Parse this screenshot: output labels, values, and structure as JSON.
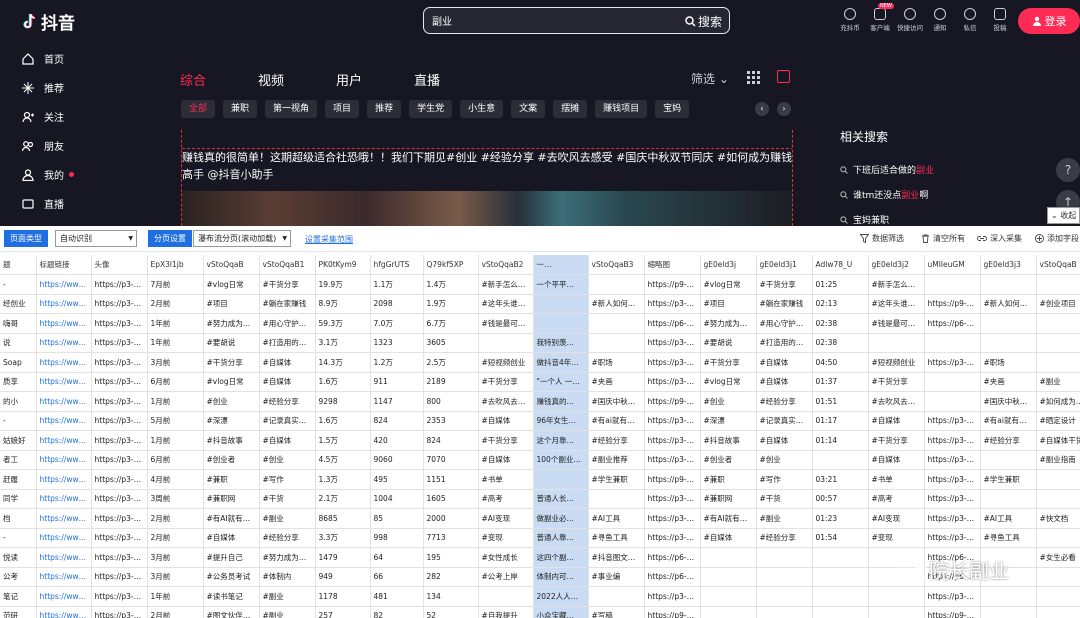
{
  "app": {
    "name": "抖音"
  },
  "search": {
    "value": "副业",
    "button": "搜索"
  },
  "tools": [
    {
      "label": "充抖币",
      "new": ""
    },
    {
      "label": "客户端",
      "new": "NEW"
    },
    {
      "label": "快捷访问",
      "new": ""
    },
    {
      "label": "通知",
      "new": ""
    },
    {
      "label": "私信",
      "new": ""
    },
    {
      "label": "投稿",
      "new": ""
    }
  ],
  "login": "登录",
  "sidebar": [
    {
      "label": "首页"
    },
    {
      "label": "推荐"
    },
    {
      "label": "关注"
    },
    {
      "label": "朋友"
    },
    {
      "label": "我的"
    },
    {
      "label": "直播"
    }
  ],
  "tabs": [
    "综合",
    "视频",
    "用户",
    "直播"
  ],
  "filter": "筛选",
  "categories": [
    "全部",
    "兼职",
    "第一视角",
    "项目",
    "推荐",
    "学生党",
    "小生意",
    "文案",
    "摆摊",
    "赚钱项目",
    "宝妈",
    "创"
  ],
  "post": {
    "text": "赚钱真的很简单！这期超级适合社恐哦！！我们下期见#创业 #经验分享 #去吹风去感受 #国庆中秋双节同庆 #如何成为赚钱高手 @抖音小助手"
  },
  "related": {
    "title": "相关搜索",
    "items": [
      {
        "pre": "下班后适合做的",
        "hl": "副业"
      },
      {
        "pre": "谁tm还没点",
        "hl": "副业",
        "post": "啊"
      },
      {
        "pre": "宝妈兼职",
        "hl": "",
        "post": ""
      }
    ]
  },
  "collapse": "收起",
  "panel": {
    "page_type_btn": "页面类型",
    "page_type_val": "自动识别",
    "paging_btn": "分页设置",
    "paging_val": "瀑布流分页(滚动加载)",
    "range_link": "设置采集范围",
    "actions": [
      "数据筛选",
      "清空所有",
      "深入采集",
      "添加字段"
    ]
  },
  "table": {
    "headers": [
      "题",
      "标题链接",
      "头像",
      "EpX3l1jb",
      "vStoQqaB",
      "vStoQqaB1",
      "PK0tKym9",
      "hfgGrUTS",
      "Q79kf5XP",
      "vStoQqaB2",
      "一…",
      "vStoQqaB3",
      "缩略图",
      "gE0eld3j",
      "gE0eld3j1",
      "Adlw78_U",
      "gE0eld3j2",
      "uMIleuGM",
      "gE0eld3j3",
      "vStoQqaB"
    ],
    "rows": [
      [
        "-",
        "https://ww…",
        "https://p3-…",
        "7月前",
        "#vlog日常",
        "#干货分享",
        "19.9万",
        "1.1万",
        "1.4万",
        "#新手怎么…",
        "一个平平…",
        "",
        "https://p9-…",
        "#vlog日常",
        "#干货分享",
        "01:25",
        "#新手怎么…",
        "",
        "",
        ""
      ],
      [
        "经创业",
        "https://ww…",
        "https://p3-…",
        "2月前",
        "#项目",
        "#躺在家赚钱",
        "8.9万",
        "2098",
        "1.9万",
        "#这年头谁…",
        "",
        "#新人如何…",
        "https://p3-…",
        "#项目",
        "#躺在家赚钱",
        "02:13",
        "#这年头谁…",
        "https://p9-…",
        "#新人如何…",
        "#创业项目"
      ],
      [
        "嗨哥",
        "https://ww…",
        "https://p3-…",
        "1年前",
        "#努力成为…",
        "#用心守护…",
        "59.3万",
        "7.0万",
        "6.7万",
        "#钱是最可…",
        "",
        "",
        "https://p6-…",
        "#努力成为…",
        "#用心守护…",
        "02:38",
        "#钱是最可…",
        "https://p6-…",
        "",
        ""
      ],
      [
        "说",
        "https://ww…",
        "https://p3-…",
        "1年前",
        "#要胡说",
        "#打造用的…",
        "3.1万",
        "1323",
        "3605",
        "",
        "我特别羡…",
        "",
        "https://p3-…",
        "#要胡说",
        "#打造用的…",
        "02:38",
        "",
        "",
        "",
        ""
      ],
      [
        "Soap",
        "https://ww…",
        "https://p3-…",
        "3月前",
        "#干货分享",
        "#自媒体",
        "14.3万",
        "1.2万",
        "2.5万",
        "#短视频创业",
        "做抖音4年…",
        "#职场",
        "https://p3-…",
        "#干货分享",
        "#自媒体",
        "04:50",
        "#短视频创业",
        "https://p3-…",
        "#职场",
        ""
      ],
      [
        "质享",
        "https://ww…",
        "https://p3-…",
        "6月前",
        "#vlog日常",
        "#自媒体",
        "1.6万",
        "911",
        "2189",
        "#干货分享",
        "\"一个人 一…",
        "#夹画",
        "https://p3-…",
        "#vlog日常",
        "#自媒体",
        "01:37",
        "#干货分享",
        "",
        "#夹画",
        "#副业"
      ],
      [
        "的小",
        "https://ww…",
        "https://p3-…",
        "1月前",
        "#创业",
        "#经验分享",
        "9298",
        "1147",
        "800",
        "#去吹风去…",
        "赚钱真的…",
        "#国庆中秋…",
        "https://p9-…",
        "#创业",
        "#经验分享",
        "01:51",
        "#去吹风去…",
        "",
        "#国庆中秋…",
        "#如何成为…"
      ],
      [
        "-",
        "https://ww…",
        "https://p3-…",
        "5月前",
        "#深漂",
        "#记录真实…",
        "1.6万",
        "824",
        "2353",
        "#自媒体",
        "96年女生…",
        "#有ai就有…",
        "https://p3-…",
        "#深漂",
        "#记录真实…",
        "01:17",
        "#自媒体",
        "https://p3-…",
        "#有ai就有…",
        "#晒定设计"
      ],
      [
        "姑娘好",
        "https://ww…",
        "https://p3-…",
        "1月前",
        "#抖音故事",
        "#自媒体",
        "1.5万",
        "420",
        "824",
        "#干货分享",
        "这个月靠…",
        "#经验分享",
        "https://p3-…",
        "#抖音故事",
        "#自媒体",
        "01:14",
        "#干货分享",
        "https://p3-…",
        "#经验分享",
        "#自媒体干货"
      ],
      [
        "者工",
        "https://ww…",
        "https://p3-…",
        "6月前",
        "#创业者",
        "#创业",
        "4.5万",
        "9060",
        "7070",
        "#自媒体",
        "100个副业…",
        "#副业推荐",
        "https://p3-…",
        "#创业者",
        "#创业",
        "",
        "#自媒体",
        "https://p3-…",
        "",
        "#副业指南"
      ],
      [
        "赶履",
        "https://ww…",
        "https://p3-…",
        "4月前",
        "#兼职",
        "#写作",
        "1.3万",
        "495",
        "1151",
        "#书单",
        "",
        "#学生兼职",
        "https://p9-…",
        "#兼职",
        "#写作",
        "03:21",
        "#书单",
        "https://p3-…",
        "#学生兼职",
        ""
      ],
      [
        "同学",
        "https://ww…",
        "https://p3-…",
        "3周前",
        "#兼职网",
        "#干货",
        "2.1万",
        "1004",
        "1605",
        "#高考",
        "普通人长…",
        "",
        "https://p3-…",
        "#兼职网",
        "#干货",
        "00:57",
        "#高考",
        "https://p3-…",
        "",
        ""
      ],
      [
        "档",
        "https://ww…",
        "https://p3-…",
        "2月前",
        "#有AI就有…",
        "#副业",
        "8685",
        "85",
        "2000",
        "#AI变现",
        "做副业必…",
        "#AI工具",
        "https://p3-…",
        "#有AI就有…",
        "#副业",
        "01:23",
        "#AI变现",
        "https://p3-…",
        "#AI工具",
        "#快文档"
      ],
      [
        "-",
        "https://ww…",
        "https://p3-…",
        "2月前",
        "#自媒体",
        "#经验分享",
        "3.3万",
        "998",
        "7713",
        "#变现",
        "普通人靠…",
        "#寻鱼工具",
        "https://p3-…",
        "#自媒体",
        "#经验分享",
        "01:54",
        "#变现",
        "https://p3-…",
        "#寻鱼工具",
        ""
      ],
      [
        "悦读",
        "https://ww…",
        "https://p3-…",
        "3月前",
        "#提升自己",
        "#努力成为…",
        "1479",
        "64",
        "195",
        "#女性成长",
        "这四个副…",
        "#抖音图文…",
        "https://p6-…",
        "",
        "",
        "",
        "",
        "https://p6-…",
        "",
        "#女生必看"
      ],
      [
        "公考",
        "https://ww…",
        "https://p3-…",
        "3月前",
        "#公务员考试",
        "#体制内",
        "949",
        "66",
        "282",
        "#公考上岸",
        "体制内可…",
        "#事业编",
        "https://p6-…",
        "",
        "",
        "",
        "",
        "https://p6-…",
        "",
        ""
      ],
      [
        "笔记",
        "https://ww…",
        "https://p3-…",
        "1年前",
        "#读书笔记",
        "#副业",
        "1178",
        "481",
        "134",
        "",
        "2022人人…",
        "",
        "https://p3-…",
        "",
        "",
        "",
        "",
        "https://p3-…",
        "",
        ""
      ],
      [
        "范研",
        "https://ww…",
        "https://p3-…",
        "2月前",
        "#图文伙伴…",
        "#副业",
        "257",
        "82",
        "52",
        "#自我提升",
        "小众宝藏…",
        "#写稿",
        "https://p9-…",
        "",
        "",
        "",
        "",
        "https://p9-…",
        "",
        ""
      ]
    ]
  },
  "watermark": "院长副业"
}
